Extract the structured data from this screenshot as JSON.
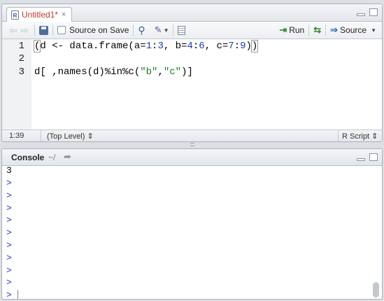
{
  "editor": {
    "tab_title": "Untitled1*",
    "tab_close": "×",
    "r_icon": "R",
    "toolbar": {
      "source_on_save": "Source on Save",
      "run": "Run",
      "source": "Source",
      "back_icon": "arrow-left-icon",
      "forward_icon": "arrow-right-icon"
    },
    "lines": [
      {
        "num": "1"
      },
      {
        "num": "2"
      },
      {
        "num": "3"
      }
    ],
    "code_text": {
      "l1_a": "d <- data.frame(a=",
      "l1_n1": "1",
      "l1_b": ":",
      "l1_n2": "3",
      "l1_c": ", b=",
      "l1_n3": "4",
      "l1_d": ":",
      "l1_n4": "6",
      "l1_e": ", c=",
      "l1_n5": "7",
      "l1_f": ":",
      "l1_n6": "9",
      "l1_g": ")",
      "l1_open": "(",
      "l1_close": ")",
      "l3_a": "d[ ,names(d)%in%c(",
      "l3_s1": "\"b\"",
      "l3_b": ",",
      "l3_s2": "\"c\"",
      "l3_c": ")]"
    },
    "status": {
      "position": "1:39",
      "scope": "(Top Level) ⇕",
      "file_type": "R Script ⇕"
    }
  },
  "console": {
    "title": "Console",
    "path": "~/",
    "output": "3",
    "prompt": ">",
    "prompt_count": 10
  },
  "colors": {
    "tab_title": "#c0392b",
    "prompt": "#2233cc",
    "number": "#1a3fb0",
    "string": "#1e7a1e"
  }
}
